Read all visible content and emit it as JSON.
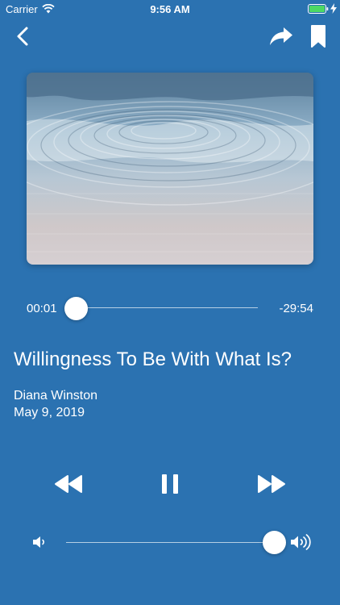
{
  "status_bar": {
    "carrier": "Carrier",
    "time": "9:56 AM",
    "icons": [
      "wifi-icon",
      "battery-icon",
      "charging-bolt-icon"
    ]
  },
  "nav": {
    "icons": [
      "back-chevron-icon",
      "share-arrow-icon",
      "bookmark-icon"
    ]
  },
  "artwork": {
    "description_icon": "water-ripples-image"
  },
  "player": {
    "elapsed": "00:01",
    "remaining": "-29:54",
    "progress_fraction": 0.0003,
    "volume_fraction": 0.95
  },
  "track": {
    "title": "Willingness To Be With What Is?",
    "author": "Diana Winston",
    "date": "May 9, 2019"
  },
  "controls": {
    "icons": [
      "rewind-icon",
      "pause-icon",
      "fast-forward-icon"
    ]
  },
  "colors": {
    "background": "#2b72b1",
    "foreground": "#ffffff",
    "battery_fill": "#4cd964"
  }
}
